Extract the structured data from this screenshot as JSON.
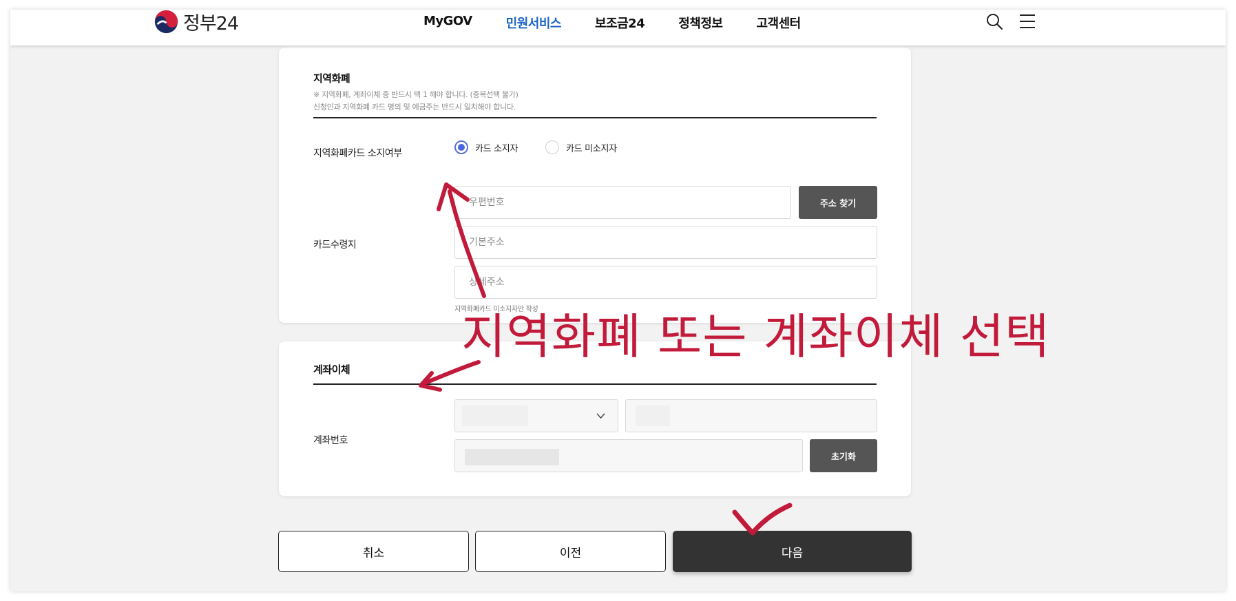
{
  "header": {
    "logo_text": "정부24",
    "nav": [
      "MyGOV",
      "민원서비스",
      "보조금24",
      "정책정보",
      "고객센터"
    ],
    "active_nav_index": 1,
    "active_color": "#1a64c8"
  },
  "local_currency": {
    "title": "지역화폐",
    "note1": "※ 지역화폐, 계좌이체 중 반드시 택 1 해야 합니다. (중복선택 불가)",
    "note2": "신청인과 지역화폐 카드 명의 및 예금주는 반드시 일치해야 합니다.",
    "card_owned_label": "지역화폐카드 소지여부",
    "radio_owner": "카드 소지자",
    "radio_non_owner": "카드 미소지자",
    "selected": "카드 소지자",
    "card_address_label": "카드수령지",
    "postcode_placeholder": "우편번호",
    "find_address_button": "주소 찾기",
    "basic_address_placeholder": "기본주소",
    "detail_address_placeholder": "상세주소",
    "help_text": "지역화폐카드 미소지자만 작성"
  },
  "bank_transfer": {
    "title": "계좌이체",
    "account_label": "계좌번호",
    "reset_button": "초기화"
  },
  "actions": {
    "cancel": "취소",
    "prev": "이전",
    "next": "다음"
  },
  "annotation": {
    "text": "지역화폐 또는 계좌이체 선택",
    "color": "#c21a3a"
  }
}
